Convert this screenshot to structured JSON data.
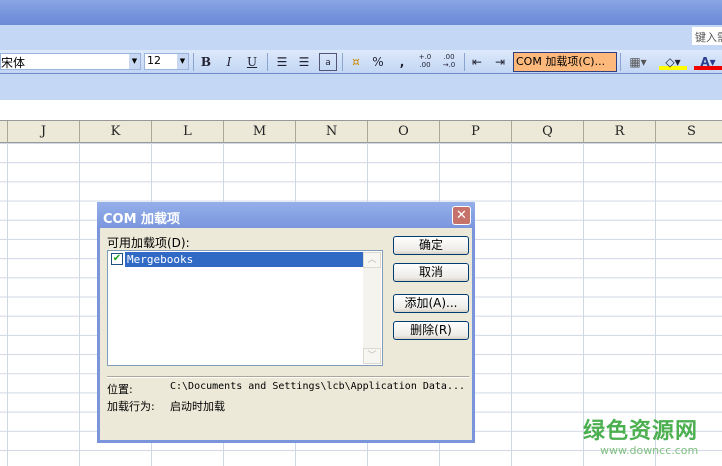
{
  "askbox": "键入需",
  "toolbar": {
    "font": "宋体",
    "size": "12",
    "bold": "B",
    "italic": "I",
    "underline": "U",
    "percent": "%",
    "comma": ",",
    "inc_decimal": "+.0\n.00",
    "dec_decimal": ".00\n→.0",
    "com_addins": "COM 加载项(C)..."
  },
  "columns": [
    "J",
    "K",
    "L",
    "M",
    "N",
    "O",
    "P",
    "Q",
    "R",
    "S"
  ],
  "dialog": {
    "title": "COM 加载项",
    "available_label": "可用加载项(D):",
    "items": [
      {
        "name": "Mergebooks",
        "checked": true,
        "selected": true
      }
    ],
    "ok": "确定",
    "cancel": "取消",
    "add": "添加(A)...",
    "remove": "删除(R)",
    "location_label": "位置:",
    "location_value": "C:\\Documents and Settings\\lcb\\Application Data...",
    "behavior_label": "加载行为:",
    "behavior_value": "启动时加载"
  },
  "watermark": {
    "text": "绿色资源网",
    "url": "www.downcc.com"
  }
}
